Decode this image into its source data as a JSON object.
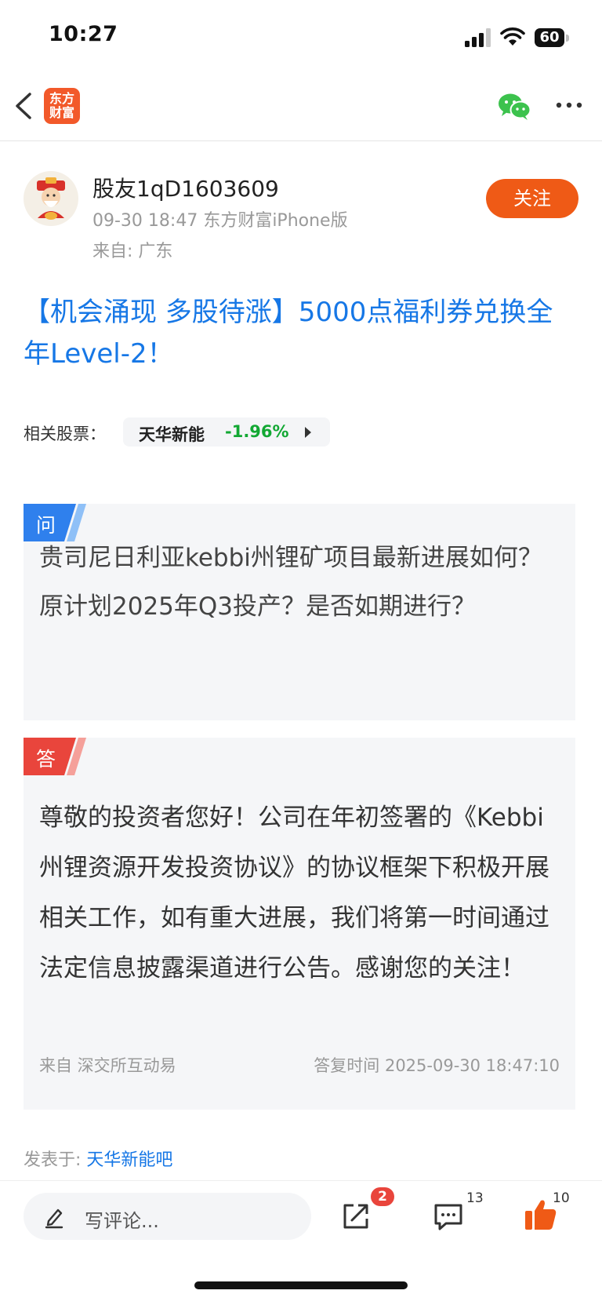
{
  "status_bar": {
    "time": "10:27",
    "battery": "60"
  },
  "nav": {
    "logo_line1": "东方",
    "logo_line2": "财富"
  },
  "author": {
    "username": "股友1qD1603609",
    "meta": "09-30 18:47 东方财富iPhone版",
    "from": "来自: 广东",
    "follow_label": "关注"
  },
  "post": {
    "headline": "【机会涌现 多股待涨】5000点福利券兑换全年Level-2！"
  },
  "related_stock": {
    "label": "相关股票：",
    "name": "天华新能",
    "change": "-1.96%",
    "change_color": "#12a833"
  },
  "qa": {
    "question_badge": "问",
    "question": "贵司尼日利亚kebbi州锂矿项目最新进展如何？原计划2025年Q3投产？是否如期进行？",
    "answer_badge": "答",
    "answer": "尊敬的投资者您好！公司在年初签署的《Kebbi州锂资源开发投资协议》的协议框架下积极开展相关工作，如有重大进展，我们将第一时间通过法定信息披露渠道进行公告。感谢您的关注！",
    "source": "来自 深交所互动易",
    "reply_time": "答复时间 2025-09-30 18:47:10"
  },
  "posted_in": {
    "label": "发表于: ",
    "forum": "天华新能吧"
  },
  "bottom_bar": {
    "comment_placeholder": "写评论...",
    "share_badge": "2",
    "comment_count": "13",
    "like_count": "10"
  },
  "colors": {
    "accent_orange": "#ef5a16",
    "link_blue": "#1677e6",
    "question_blue": "#2f80ed",
    "answer_red": "#e9453c"
  }
}
